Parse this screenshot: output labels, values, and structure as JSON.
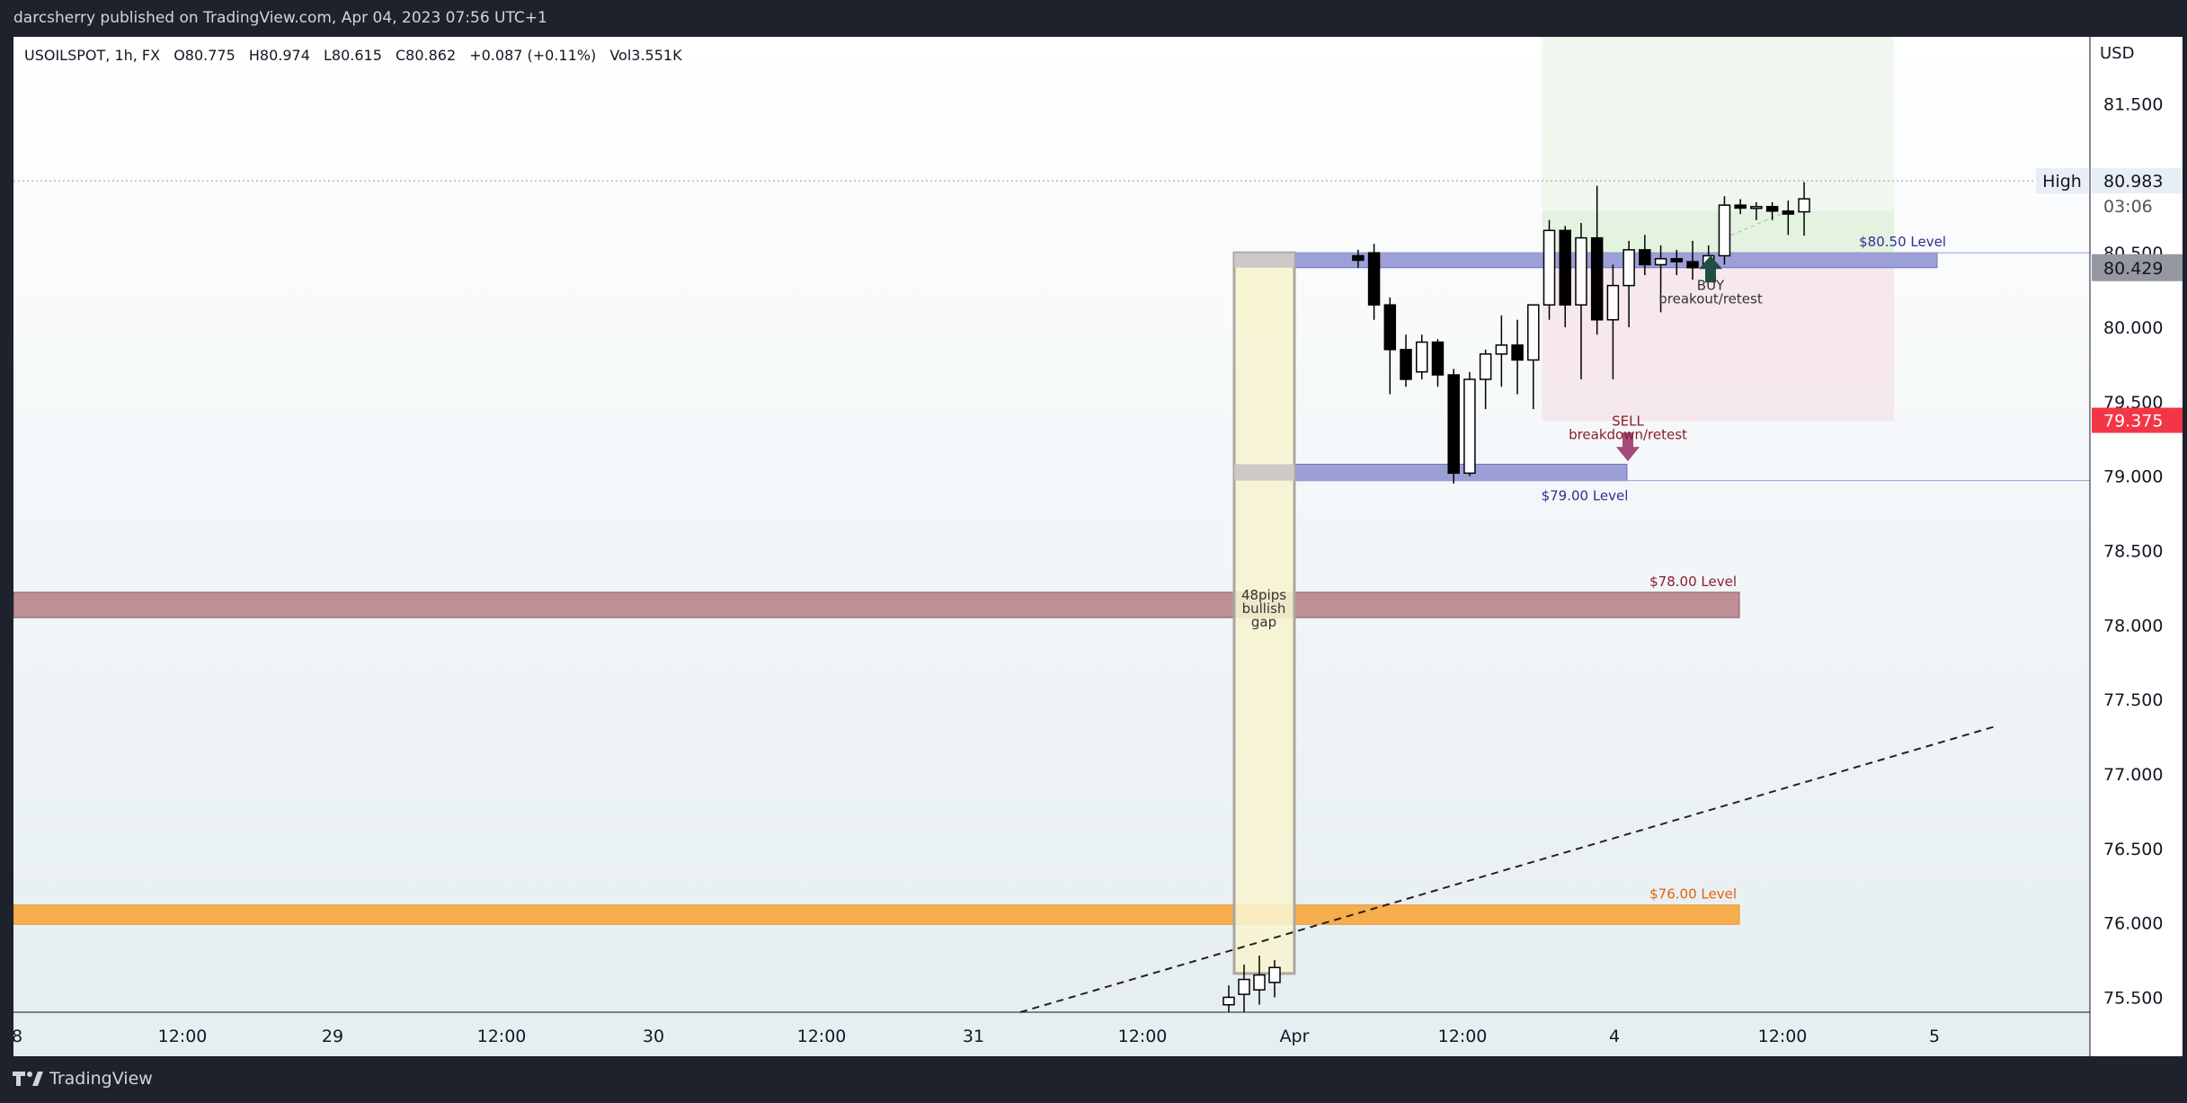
{
  "header": {
    "publisher": "darcsherry published on TradingView.com, Apr 04, 2023 07:56 UTC+1"
  },
  "legend": {
    "symbol": "USOILSPOT, 1h, FX",
    "open": "O80.775",
    "high": "H80.974",
    "low": "L80.615",
    "close": "C80.862",
    "change": "+0.087 (+0.11%)",
    "volume": "Vol3.551K"
  },
  "price_axis": {
    "title": "USD",
    "high_label": "High",
    "high_value": "80.983",
    "countdown": "03:06",
    "current_price": "80.429",
    "red_marker": "79.375"
  },
  "footer": {
    "brand": "TradingView"
  },
  "colors": {
    "down_candle": "#000000",
    "up_candle": "#ffffff",
    "zone_blue": "#8c8fd0",
    "zone_red": "#b9848c",
    "zone_orange": "#f6ad4b",
    "gap_fill": "#f7f4cf",
    "buy_arrow": "#1e4e45",
    "sell_arrow": "#a74a79",
    "price_red": "#f23645"
  },
  "chart_data": {
    "type": "candlestick",
    "symbol": "USOILSPOT",
    "timeframe": "1h",
    "ylim": [
      75.4,
      81.95
    ],
    "y_ticks": [
      75.5,
      76.0,
      76.5,
      77.0,
      77.5,
      78.0,
      78.5,
      79.0,
      79.5,
      80.0,
      80.5,
      81.0,
      81.5
    ],
    "y_tick_labels": [
      "75.500",
      "76.000",
      "76.500",
      "77.000",
      "77.500",
      "78.000",
      "78.500",
      "79.000",
      "79.500",
      "80.000",
      "80.500",
      "",
      "81.500"
    ],
    "x_ticks": [
      "8",
      "12:00",
      "29",
      "12:00",
      "30",
      "12:00",
      "31",
      "12:00",
      "Apr",
      "12:00",
      "4",
      "12:00",
      "5"
    ],
    "candles": [
      {
        "o": 75.45,
        "h": 75.58,
        "l": 75.4,
        "c": 75.5
      },
      {
        "o": 75.52,
        "h": 75.72,
        "l": 75.4,
        "c": 75.62
      },
      {
        "o": 75.55,
        "h": 75.78,
        "l": 75.45,
        "c": 75.65
      },
      {
        "o": 75.6,
        "h": 75.75,
        "l": 75.5,
        "c": 75.7
      },
      {
        "o": 80.48,
        "h": 80.52,
        "l": 80.4,
        "c": 80.45
      },
      {
        "o": 80.5,
        "h": 80.56,
        "l": 80.05,
        "c": 80.15
      },
      {
        "o": 80.15,
        "h": 80.2,
        "l": 79.55,
        "c": 79.85
      },
      {
        "o": 79.85,
        "h": 79.95,
        "l": 79.6,
        "c": 79.65
      },
      {
        "o": 79.7,
        "h": 79.95,
        "l": 79.65,
        "c": 79.9
      },
      {
        "o": 79.9,
        "h": 79.92,
        "l": 79.6,
        "c": 79.68
      },
      {
        "o": 79.68,
        "h": 79.72,
        "l": 78.95,
        "c": 79.02
      },
      {
        "o": 79.02,
        "h": 79.7,
        "l": 79.0,
        "c": 79.65
      },
      {
        "o": 79.65,
        "h": 79.85,
        "l": 79.45,
        "c": 79.82
      },
      {
        "o": 79.82,
        "h": 80.08,
        "l": 79.6,
        "c": 79.88
      },
      {
        "o": 79.88,
        "h": 80.05,
        "l": 79.55,
        "c": 79.78
      },
      {
        "o": 79.78,
        "h": 80.15,
        "l": 79.45,
        "c": 80.15
      },
      {
        "o": 80.15,
        "h": 80.72,
        "l": 80.05,
        "c": 80.65
      },
      {
        "o": 80.65,
        "h": 80.68,
        "l": 80.0,
        "c": 80.15
      },
      {
        "o": 80.15,
        "h": 80.7,
        "l": 79.65,
        "c": 80.6
      },
      {
        "o": 80.6,
        "h": 80.95,
        "l": 79.95,
        "c": 80.05
      },
      {
        "o": 80.05,
        "h": 80.42,
        "l": 79.65,
        "c": 80.28
      },
      {
        "o": 80.28,
        "h": 80.58,
        "l": 80.0,
        "c": 80.52
      },
      {
        "o": 80.52,
        "h": 80.62,
        "l": 80.35,
        "c": 80.42
      },
      {
        "o": 80.42,
        "h": 80.55,
        "l": 80.1,
        "c": 80.46
      },
      {
        "o": 80.46,
        "h": 80.52,
        "l": 80.35,
        "c": 80.44
      },
      {
        "o": 80.44,
        "h": 80.58,
        "l": 80.32,
        "c": 80.4
      },
      {
        "o": 80.4,
        "h": 80.55,
        "l": 80.35,
        "c": 80.48
      },
      {
        "o": 80.48,
        "h": 80.88,
        "l": 80.42,
        "c": 80.82
      },
      {
        "o": 80.82,
        "h": 80.86,
        "l": 80.76,
        "c": 80.8
      },
      {
        "o": 80.8,
        "h": 80.84,
        "l": 80.72,
        "c": 80.81
      },
      {
        "o": 80.81,
        "h": 80.84,
        "l": 80.72,
        "c": 80.78
      },
      {
        "o": 80.78,
        "h": 80.85,
        "l": 80.62,
        "c": 80.76
      },
      {
        "o": 80.775,
        "h": 80.974,
        "l": 80.615,
        "c": 80.862
      }
    ],
    "levels": [
      {
        "label": "$80.50 Level",
        "y_low": 80.4,
        "y_high": 80.5
      },
      {
        "label": "$79.00 Level",
        "y_low": 78.97,
        "y_high": 79.08
      },
      {
        "label": "$78.00 Level",
        "y_low": 78.05,
        "y_high": 78.22
      },
      {
        "label": "$76.00 Level",
        "y_low": 75.99,
        "y_high": 76.12
      }
    ],
    "annotations": [
      {
        "text": "48pips\nbullish\ngap"
      },
      {
        "text": "BUY\nbreakout/retest"
      },
      {
        "text": "SELL\nbreakdown/retest"
      }
    ],
    "high_line": 80.983,
    "grid": false,
    "legend_position": "top-left"
  }
}
